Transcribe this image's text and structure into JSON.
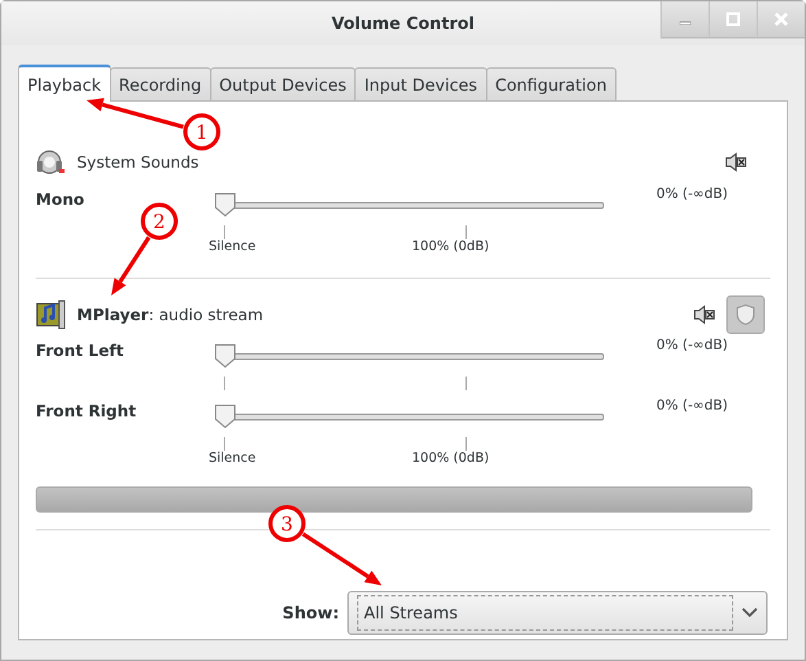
{
  "window": {
    "title": "Volume Control"
  },
  "tabs": [
    {
      "label": "Playback",
      "selected": true
    },
    {
      "label": "Recording",
      "selected": false
    },
    {
      "label": "Output Devices",
      "selected": false
    },
    {
      "label": "Input Devices",
      "selected": false
    },
    {
      "label": "Configuration",
      "selected": false
    }
  ],
  "streams": [
    {
      "kind": "system",
      "name": "System Sounds",
      "channels": [
        {
          "name": "Mono",
          "level": 0,
          "reading": "0% (-∞dB)"
        }
      ],
      "scale": [
        "Silence",
        "100% (0dB)"
      ]
    },
    {
      "kind": "app",
      "name": "MPlayer",
      "description": ": audio stream",
      "locked": true,
      "channels": [
        {
          "name": "Front Left",
          "level": 0,
          "reading": "0% (-∞dB)"
        },
        {
          "name": "Front Right",
          "level": 0,
          "reading": "0% (-∞dB)"
        }
      ],
      "scale": [
        "Silence",
        "100% (0dB)"
      ],
      "meter": {
        "level": 0
      }
    }
  ],
  "footer": {
    "label": "Show:",
    "value": "All Streams"
  },
  "callouts": [
    "1",
    "2",
    "3"
  ]
}
